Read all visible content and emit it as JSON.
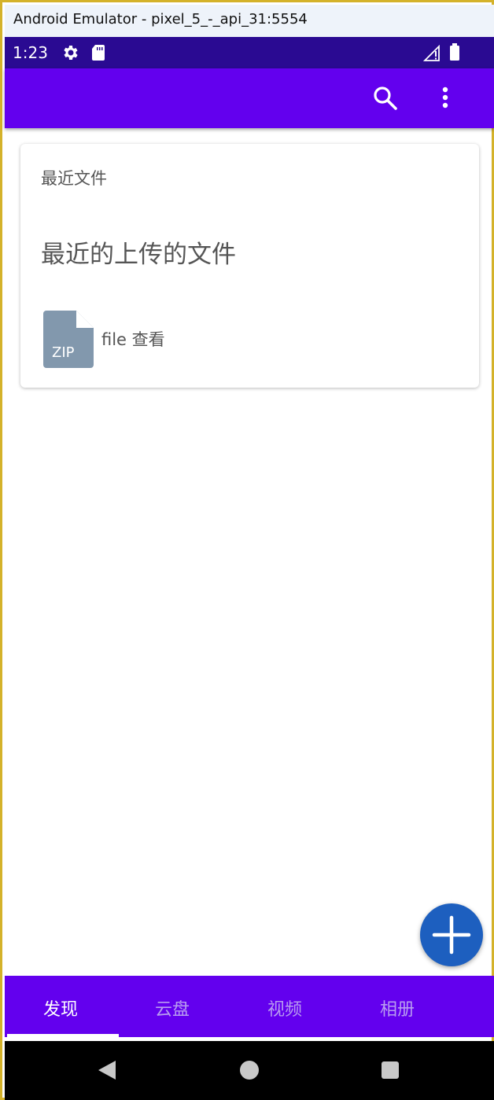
{
  "window": {
    "title": "Android Emulator - pixel_5_-_api_31:5554"
  },
  "statusbar": {
    "time": "1:23",
    "icons": [
      "gear-icon",
      "sd-card-icon",
      "signal-icon",
      "battery-icon"
    ]
  },
  "appbar": {
    "icons": [
      "search-icon",
      "more-vert-icon"
    ]
  },
  "card": {
    "title": "最近文件",
    "headline": "最近的上传的文件",
    "file": {
      "type": "ZIP",
      "label": "file 查看"
    }
  },
  "fab": {
    "icon": "add-icon"
  },
  "tabs": [
    {
      "label": "发现",
      "active": true
    },
    {
      "label": "云盘",
      "active": false
    },
    {
      "label": "视频",
      "active": false
    },
    {
      "label": "相册",
      "active": false
    }
  ],
  "navbar": {
    "icons": [
      "back-icon",
      "home-icon",
      "recents-icon"
    ]
  },
  "colors": {
    "primary": "#6300ee",
    "status_bar": "#2a0a92",
    "fab": "#1d5fbf",
    "inactive_tab": "#b89cf0",
    "file_icon": "#8298ad"
  }
}
